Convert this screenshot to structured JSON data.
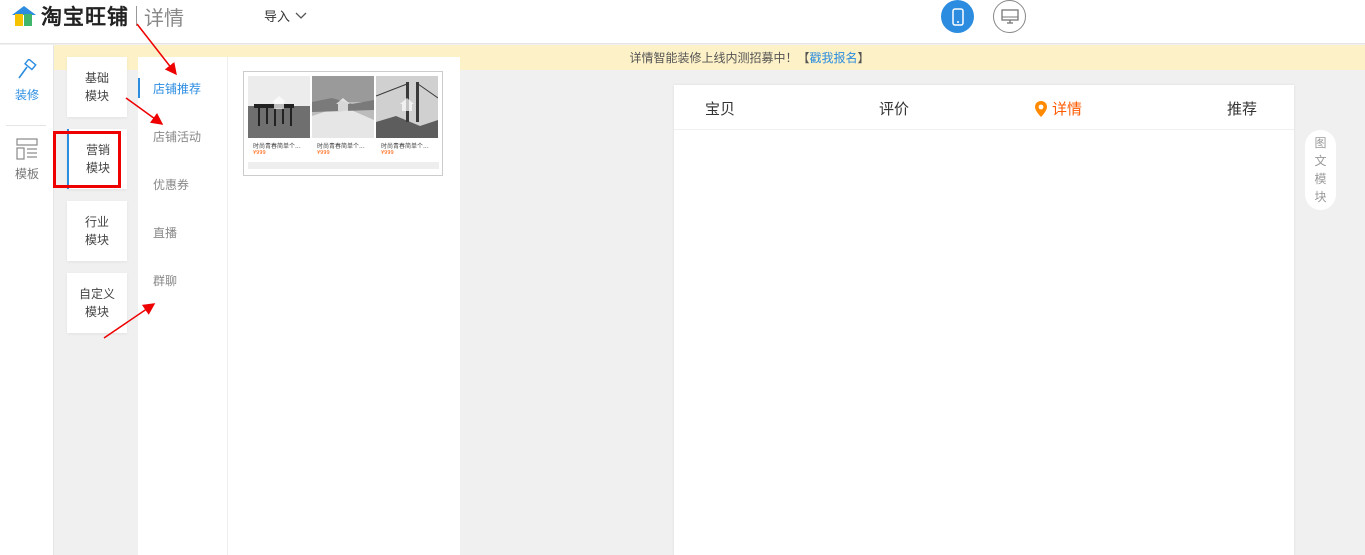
{
  "header": {
    "brand": "淘宝旺铺",
    "subtitle": "详情",
    "import_label": "导入",
    "device_mobile_icon": "mobile-icon",
    "device_pc_icon": "monitor-icon"
  },
  "notice": {
    "text": "详情智能装修上线内测招募中！",
    "link_open": "【",
    "link_label": "戳我报名",
    "link_close": "】"
  },
  "rail": {
    "items": [
      {
        "label": "装修",
        "icon": "hammer-icon",
        "active": true
      },
      {
        "label": "模板",
        "icon": "template-icon",
        "active": false
      }
    ]
  },
  "categories": [
    {
      "line1": "基础",
      "line2": "模块"
    },
    {
      "line1": "营销",
      "line2": "模块"
    },
    {
      "line1": "行业",
      "line2": "模块"
    },
    {
      "line1": "自定义",
      "line2": "模块"
    }
  ],
  "submenu": [
    "店铺推荐",
    "店铺活动",
    "优惠券",
    "直播",
    "群聊"
  ],
  "thumbnail": {
    "items": [
      {
        "title": "时尚青春简单个...",
        "price": "¥999"
      },
      {
        "title": "时尚青春简单个...",
        "price": "¥999"
      },
      {
        "title": "时尚青春简单个...",
        "price": "¥999"
      }
    ]
  },
  "preview": {
    "tabs": [
      "宝贝",
      "评价",
      "详情",
      "推荐"
    ],
    "active_tab": "详情"
  },
  "side_tool": {
    "chars": [
      "图",
      "文",
      "模",
      "块"
    ]
  },
  "colors": {
    "accent": "#2b8ce0",
    "active_tab": "#ff5a00",
    "annotation": "#e00000",
    "notice_bg": "#fdf1c7"
  }
}
